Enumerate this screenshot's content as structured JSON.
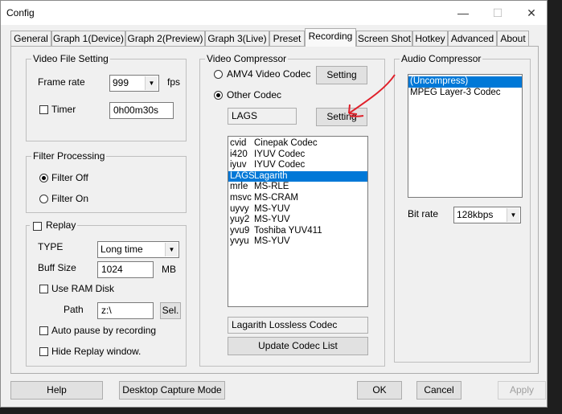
{
  "window": {
    "title": "Config",
    "minimize": "—",
    "maximize": "☐",
    "close": "✕"
  },
  "tabs": [
    "General",
    "Graph 1(Device)",
    "Graph 2(Preview)",
    "Graph 3(Live)",
    "Preset",
    "Recording",
    "Screen Shot",
    "Hotkey",
    "Advanced",
    "About"
  ],
  "active_tab": "Recording",
  "video_file": {
    "title": "Video File Setting",
    "frame_rate_label": "Frame rate",
    "frame_rate_value": "999",
    "fps_label": "fps",
    "timer_label": "Timer",
    "timer_value": "0h00m30s"
  },
  "filter": {
    "title": "Filter Processing",
    "off_label": "Filter Off",
    "on_label": "Filter On"
  },
  "replay": {
    "title": "Replay",
    "type_label": "TYPE",
    "type_value": "Long time",
    "buff_label": "Buff Size",
    "buff_value": "1024",
    "buff_unit": "MB",
    "ram_disk_label": "Use RAM Disk",
    "path_label": "Path",
    "path_value": "z:\\",
    "sel_button": "Sel.",
    "auto_pause_label": "Auto pause by recording",
    "hide_label": "Hide Replay window."
  },
  "video_compressor": {
    "title": "Video Compressor",
    "amv4_label": "AMV4 Video Codec",
    "setting_button": "Setting",
    "other_label": "Other Codec",
    "codec_value": "LAGS",
    "setting_button_2": "Setting",
    "codecs": [
      {
        "code": "cvid",
        "name": "Cinepak Codec"
      },
      {
        "code": "i420",
        "name": "IYUV Codec"
      },
      {
        "code": "iyuv",
        "name": "IYUV Codec"
      },
      {
        "code": "LAGS",
        "name": "Lagarith"
      },
      {
        "code": "mrle",
        "name": "MS-RLE"
      },
      {
        "code": "msvc",
        "name": "MS-CRAM"
      },
      {
        "code": "uyvy",
        "name": "MS-YUV"
      },
      {
        "code": "yuy2",
        "name": "MS-YUV"
      },
      {
        "code": "yvu9",
        "name": "Toshiba YUV411"
      },
      {
        "code": "yvyu",
        "name": "MS-YUV"
      }
    ],
    "selected_index": 3,
    "codec_description": "Lagarith Lossless Codec",
    "update_button": "Update Codec List"
  },
  "audio_compressor": {
    "title": "Audio Compressor",
    "items": [
      "(Uncompress)",
      "MPEG Layer-3 Codec"
    ],
    "selected_index": 0,
    "bitrate_label": "Bit rate",
    "bitrate_value": "128kbps"
  },
  "footer": {
    "help": "Help",
    "desktop_capture": "Desktop Capture Mode",
    "ok": "OK",
    "cancel": "Cancel",
    "apply": "Apply"
  },
  "colors": {
    "selection": "#0078d7",
    "annotation": "#e0202a"
  }
}
